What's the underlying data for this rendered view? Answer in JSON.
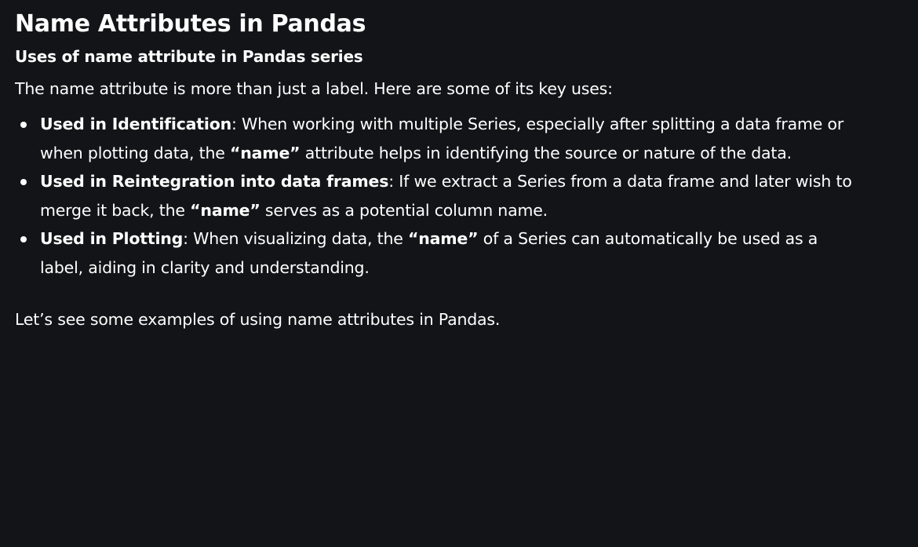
{
  "article": {
    "title": "Name Attributes in Pandas",
    "subtitle": "Uses of name attribute in Pandas series",
    "intro": "The name attribute is more than just a label. Here are some of its key uses:",
    "uses": [
      {
        "term": "Used in Identification",
        "text_1": ": When working with multiple Series, especially after splitting a data frame or when plotting data, the ",
        "emphasis": "“name”",
        "text_2": " attribute helps in identifying the source or nature of the data."
      },
      {
        "term": "Used in Reintegration into data frames",
        "text_1": ": If we extract a Series from a data frame and later wish to merge it back, the ",
        "emphasis": "“name”",
        "text_2": " serves as a potential column name."
      },
      {
        "term": "Used in Plotting",
        "text_1": ": When visualizing data, the ",
        "emphasis": "“name”",
        "text_2": " of a Series can automatically be used as a label, aiding in clarity and understanding."
      }
    ],
    "outro": "Let’s see some examples of using name attributes in Pandas."
  },
  "colors": {
    "background": "#131417",
    "text": "#ffffff"
  }
}
